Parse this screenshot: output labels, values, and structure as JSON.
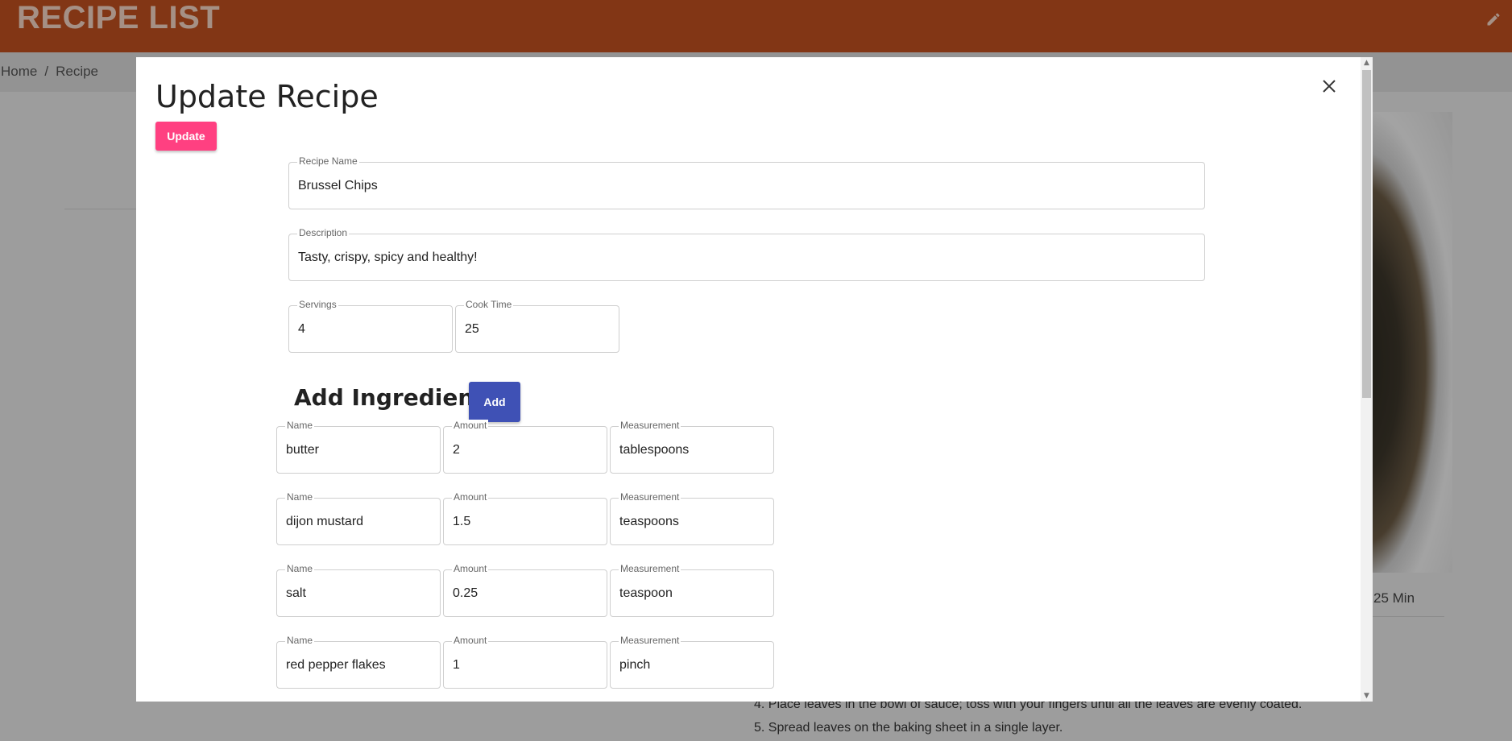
{
  "app": {
    "title": "RECIPE LIST",
    "edit_icon": "pencil-icon"
  },
  "breadcrumb": {
    "items": [
      "Home",
      "Recipe"
    ],
    "separator": "/"
  },
  "background": {
    "cook_time": "25 Min",
    "steps": [
      "4. Place leaves in the bowl of sauce; toss with your fingers until all the leaves are evenly coated.",
      "5. Spread leaves on the baking sheet in a single layer."
    ]
  },
  "modal": {
    "title": "Update Recipe",
    "update_label": "Update",
    "close_icon": "close-icon",
    "recipe_name": {
      "label": "Recipe Name",
      "value": "Brussel Chips"
    },
    "description": {
      "label": "Description",
      "value": "Tasty, crispy, spicy and healthy!"
    },
    "servings": {
      "label": "Servings",
      "value": "4"
    },
    "cook_time": {
      "label": "Cook Time",
      "value": "25"
    },
    "ingredients_title": "Add Ingredients:",
    "add_label": "Add",
    "ingredient_labels": {
      "name": "Name",
      "amount": "Amount",
      "measurement": "Measurement"
    },
    "ingredients": [
      {
        "name": "butter",
        "amount": "2",
        "measurement": "tablespoons"
      },
      {
        "name": "dijon mustard",
        "amount": "1.5",
        "measurement": "teaspoons"
      },
      {
        "name": "salt",
        "amount": "0.25",
        "measurement": "teaspoon"
      },
      {
        "name": "red pepper flakes",
        "amount": "1",
        "measurement": "pinch"
      }
    ]
  },
  "colors": {
    "header": "#c0501f",
    "update_button": "#ff4081",
    "add_button": "#3f51b5"
  }
}
